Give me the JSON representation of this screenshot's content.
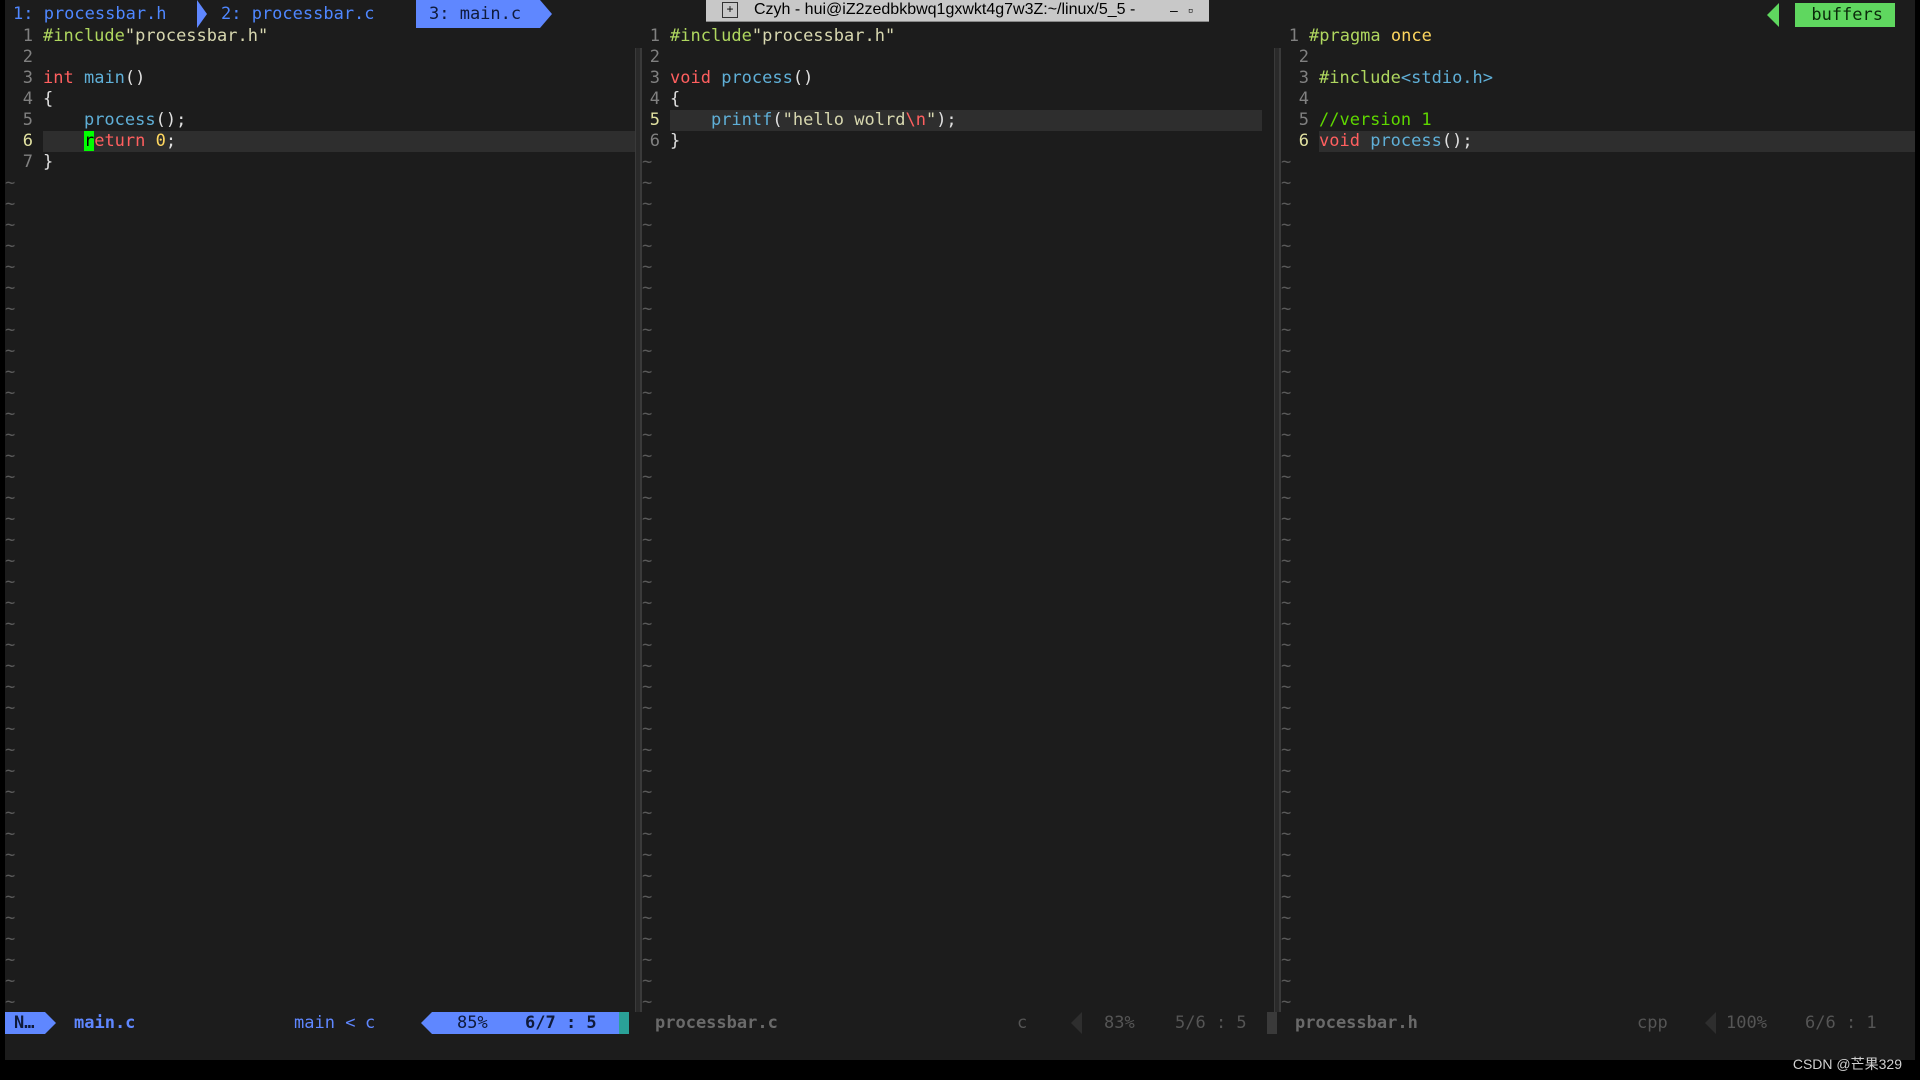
{
  "tabline": {
    "tabs": [
      {
        "label": "1: processbar.h"
      },
      {
        "label": "2: processbar.c"
      },
      {
        "label": "3: main.c"
      }
    ],
    "buffers_label": "buffers"
  },
  "terminal": {
    "title": "Czyh - hui@iZ2zedbkbwq1gxwkt4g7w3Z:~/linux/5_5 -",
    "minimize": "–",
    "restore": "▫"
  },
  "panes": [
    {
      "file": "main.c",
      "lines": [
        {
          "n": "1",
          "text": "#include\"processbar.h\""
        },
        {
          "n": "2",
          "text": ""
        },
        {
          "n": "3",
          "text": "int main()"
        },
        {
          "n": "4",
          "text": "{"
        },
        {
          "n": "5",
          "text": "    process();"
        },
        {
          "n": "6",
          "text": "    return 0;"
        },
        {
          "n": "7",
          "text": "}"
        }
      ]
    },
    {
      "file": "processbar.c",
      "lines": [
        {
          "n": "1",
          "text": "#include\"processbar.h\""
        },
        {
          "n": "2",
          "text": ""
        },
        {
          "n": "3",
          "text": "void process()"
        },
        {
          "n": "4",
          "text": "{"
        },
        {
          "n": "5",
          "text": "    printf(\"hello wolrd\\n\");"
        },
        {
          "n": "6",
          "text": "}"
        }
      ]
    },
    {
      "file": "processbar.h",
      "lines": [
        {
          "n": "1",
          "text": "#pragma once"
        },
        {
          "n": "2",
          "text": ""
        },
        {
          "n": "3",
          "text": "#include<stdio.h>"
        },
        {
          "n": "4",
          "text": ""
        },
        {
          "n": "5",
          "text": "//version 1"
        },
        {
          "n": "6",
          "text": "void process();"
        }
      ]
    }
  ],
  "statusline": {
    "mode": "N…",
    "pane1": {
      "file": "main.c",
      "func": "main",
      "func_sep": "<",
      "filetype": "c",
      "percent": "85%",
      "position": "6/7 :  5"
    },
    "pane2": {
      "file": "processbar.c",
      "filetype": "c",
      "percent": "83%",
      "position": "5/6 :  5"
    },
    "pane3": {
      "file": "processbar.h",
      "filetype": "cpp",
      "percent": "100%",
      "position": "6/6 :  1"
    }
  },
  "watermark": "CSDN @芒果329",
  "colors": {
    "background": "#1c1c1c",
    "accent_blue": "#5f87ff",
    "buffers_green": "#5fd75f",
    "keyword_red": "#ff5f5f",
    "function_cyan": "#5fafd7",
    "cursor_green": "#00ff00"
  }
}
